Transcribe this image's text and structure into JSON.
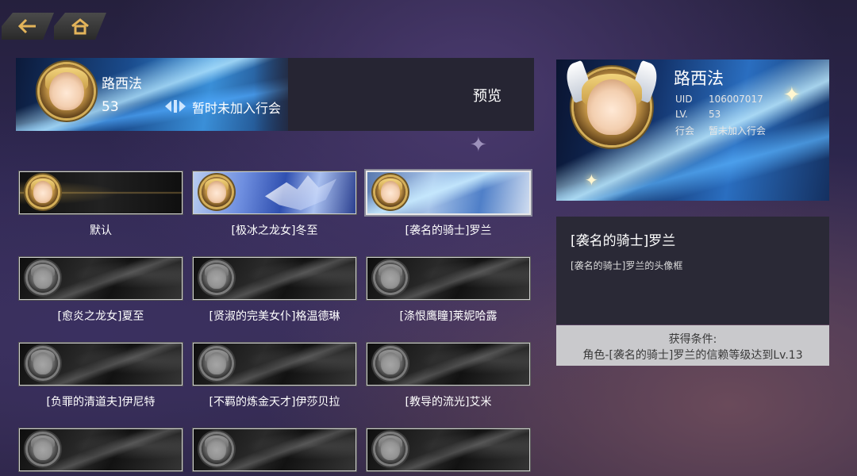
{
  "nav": {
    "back_icon": "back-arrow-icon",
    "home_icon": "home-icon"
  },
  "preview_plate": {
    "name": "路西法",
    "level": "53",
    "guild": "暂时未加入行会",
    "preview_button": "预览"
  },
  "frames": [
    {
      "label": "默认",
      "style": "default",
      "selected": false
    },
    {
      "label": "[极冰之龙女]冬至",
      "style": "ice",
      "selected": false
    },
    {
      "label": "[袭名的骑士]罗兰",
      "style": "knight",
      "selected": true
    },
    {
      "label": "[愈炎之龙女]夏至",
      "style": "dark",
      "selected": false
    },
    {
      "label": "[贤淑的完美女仆]格温德琳",
      "style": "dark",
      "selected": false
    },
    {
      "label": "[涤恨鹰瞳]莱妮哈露",
      "style": "dark",
      "selected": false
    },
    {
      "label": "[负罪的清道夫]伊尼特",
      "style": "dark",
      "selected": false
    },
    {
      "label": "[不羁的炼金天才]伊莎贝拉",
      "style": "dark",
      "selected": false
    },
    {
      "label": "[教导的流光]艾米",
      "style": "dark",
      "selected": false
    },
    {
      "label": "",
      "style": "dark",
      "selected": false
    },
    {
      "label": "",
      "style": "dark",
      "selected": false
    },
    {
      "label": "",
      "style": "dark",
      "selected": false
    }
  ],
  "profile_card": {
    "name": "路西法",
    "uid_label": "UID",
    "uid_value": "106007017",
    "lv_label": "LV.",
    "lv_value": "53",
    "guild_label": "行会",
    "guild_value": "暂未加入行会"
  },
  "detail": {
    "title": "[袭名的骑士]罗兰",
    "description": "[袭名的骑士]罗兰的头像框"
  },
  "condition": {
    "heading": "获得条件:",
    "text": "角色-[袭名的骑士]罗兰的信赖等级达到Lv.13"
  },
  "colors": {
    "accent_gold": "#d4ae58",
    "condition_bg": "#c9c9cc",
    "panel_bg": "#2a2936"
  }
}
